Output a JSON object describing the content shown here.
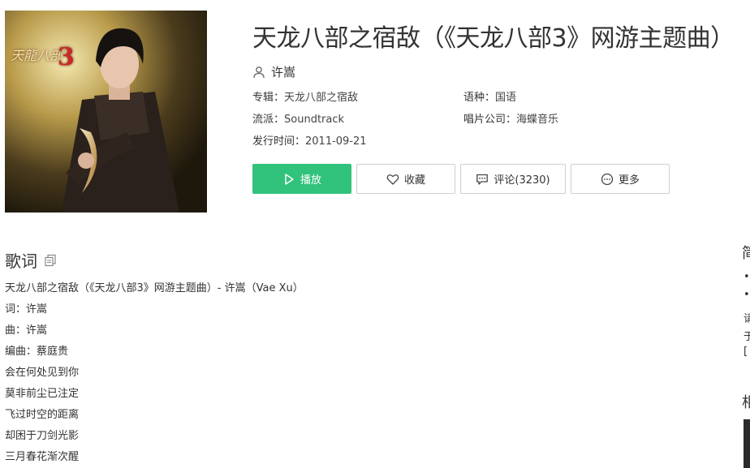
{
  "song": {
    "title": "天龙八部之宿敌（《天龙八部3》网游主题曲）",
    "artist": "许嵩",
    "cover_logo": "天龍八部",
    "cover_logo_num": "3"
  },
  "meta": {
    "album_label": "专辑：",
    "album_value": "天龙八部之宿敌",
    "language_label": "语种：",
    "language_value": "国语",
    "genre_label": "流派：",
    "genre_value": "Soundtrack",
    "company_label": "唱片公司：",
    "company_value": "海蝶音乐",
    "release_label": "发行时间：",
    "release_value": "2011-09-21"
  },
  "actions": {
    "play": "播放",
    "favorite": "收藏",
    "comment": "评论(3230)",
    "more": "更多"
  },
  "lyrics": {
    "heading": "歌词",
    "lines": [
      "天龙八部之宿敌（《天龙八部3》网游主题曲）- 许嵩（Vae Xu）",
      "词：许嵩",
      "曲：许嵩",
      "编曲：蔡庭贵",
      "会在何处见到你",
      "莫非前尘已注定",
      "飞过时空的距离",
      "却困于刀剑光影",
      "三月春花渐次醒"
    ]
  },
  "sidebar": {
    "heading_1": "简",
    "line_1": "•",
    "line_2": "•",
    "line_3": "请",
    "line_4": "于",
    "line_5": "[",
    "heading_2": "相"
  },
  "colors": {
    "accent": "#31c27c",
    "text": "#333333",
    "border": "#cfcfcf"
  },
  "icons": {
    "artist": "user-icon",
    "play": "play-icon",
    "favorite": "heart-icon",
    "comment": "comment-icon",
    "more": "more-icon",
    "copy": "copy-icon"
  }
}
